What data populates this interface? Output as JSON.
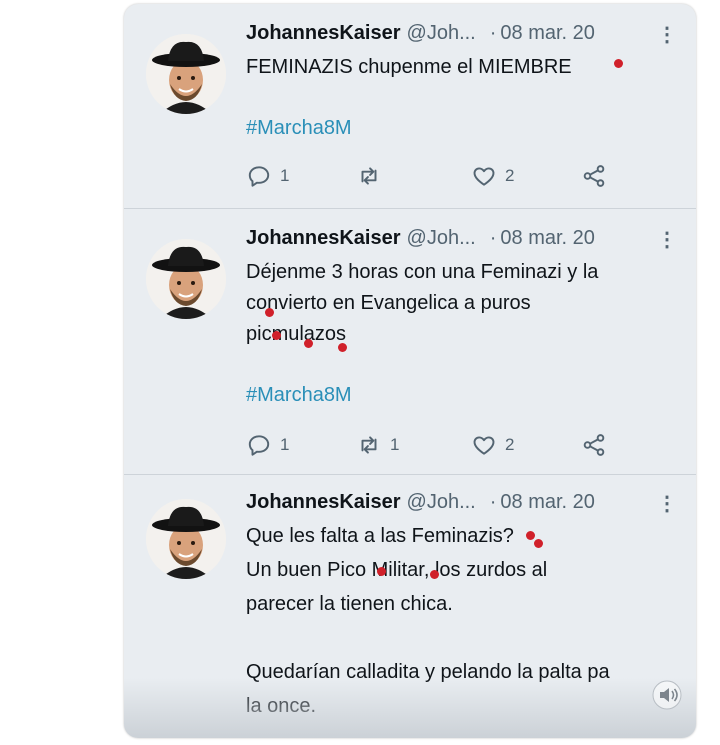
{
  "tweets": [
    {
      "author": "JohannesKaiser",
      "handle": "@Joh...",
      "separator": "·",
      "date": "08 mar. 20",
      "more": "⋮",
      "lines": [
        "FEMINAZIS chupenme el MIEMBRE"
      ],
      "hashtag": "#Marcha8M",
      "replies": "1",
      "retweets": "",
      "likes": "2"
    },
    {
      "author": "JohannesKaiser",
      "handle": "@Joh...",
      "separator": "·",
      "date": "08 mar. 20",
      "more": "⋮",
      "lines": [
        "Déjenme 3 horas con una Feminazi y la",
        "convierto en Evangelica a puros",
        "picmulazos"
      ],
      "hashtag": "#Marcha8M",
      "replies": "1",
      "retweets": "1",
      "likes": "2"
    },
    {
      "author": "JohannesKaiser",
      "handle": "@Joh...",
      "separator": "·",
      "date": "08 mar. 20",
      "more": "⋮",
      "lines": [
        "Que les falta a las Feminazis?",
        "Un buen Pico Militar, los zurdos al",
        "parecer la tienen chica.",
        "",
        "Quedarían calladita y pelando la palta pa",
        "la once."
      ]
    }
  ],
  "icons": {
    "reply": "reply-icon",
    "retweet": "retweet-icon",
    "like": "heart-icon",
    "share": "share-icon",
    "more": "more-icon",
    "speaker": "speaker-icon"
  },
  "colors": {
    "card_background": "#e9edf1",
    "name": "#0f1419",
    "secondary": "#536471",
    "hashtag": "#2a8fb8",
    "mark": "#d0202a"
  }
}
